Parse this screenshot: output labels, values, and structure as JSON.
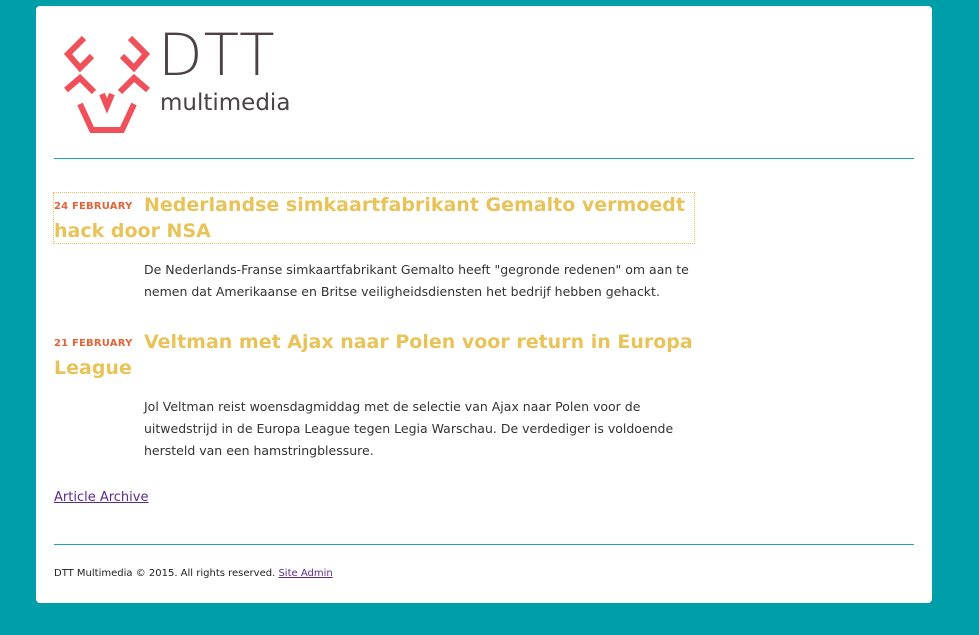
{
  "logo": {
    "word": "DTT",
    "sub": "multimedia",
    "mark_color": "#f0505a"
  },
  "articles": [
    {
      "date": "24 FEBRUARY",
      "title": "Nederlandse simkaartfabrikant Gemalto vermoedt hack door NSA",
      "summary": "De Nederlands-Franse simkaartfabrikant Gemalto heeft \"gegronde redenen\" om aan te nemen dat Amerikaanse en Britse veiligheidsdiensten het bedrijf hebben gehackt."
    },
    {
      "date": "21 FEBRUARY",
      "title": "Veltman met Ajax naar Polen voor return in Europa League",
      "summary": "Jol Veltman reist woensdagmiddag met de selectie van Ajax naar Polen voor de uitwedstrijd in de Europa League tegen Legia Warschau. De verdediger is voldoende hersteld van een hamstringblessure."
    }
  ],
  "archive_link": "Article Archive",
  "footer": {
    "text": "DTT Multimedia © 2015. All rights reserved.",
    "admin_link": "Site Admin"
  },
  "colors": {
    "background": "#009ea8",
    "title": "#e8c35a",
    "date": "#e0643a",
    "link": "#5b2b8c"
  }
}
